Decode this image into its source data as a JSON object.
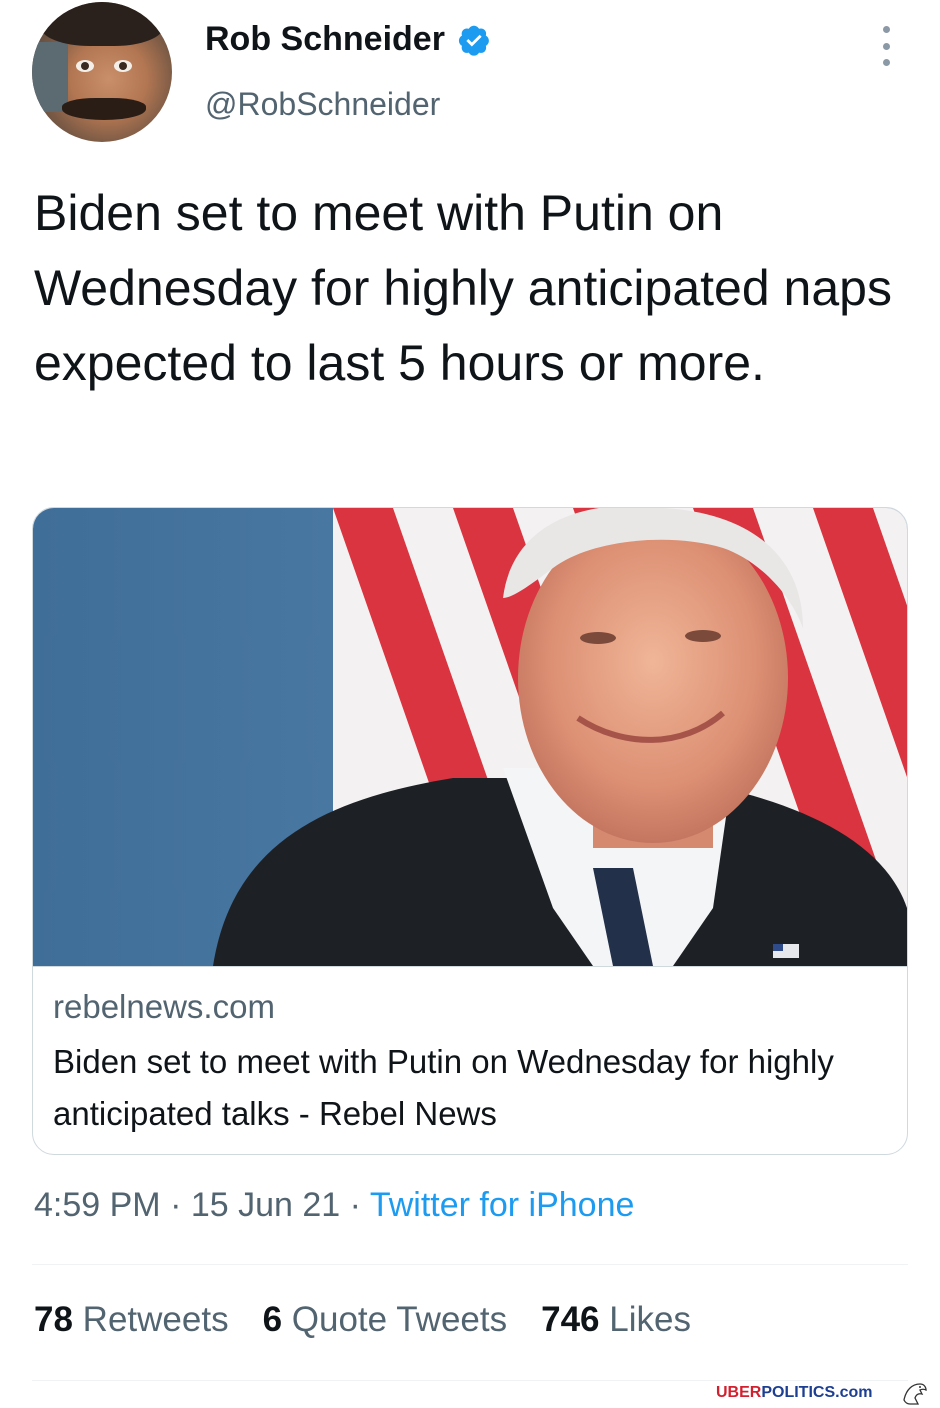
{
  "author": {
    "name": "Rob Schneider",
    "handle": "@RobSchneider",
    "verified": true
  },
  "icons": {
    "verified": "verified-badge-icon",
    "more": "more-options-icon"
  },
  "tweet": {
    "text": "Biden set to meet with Putin on Wednesday for highly anticipated naps expected to last 5 hours or more."
  },
  "card": {
    "domain": "rebelnews.com",
    "title": "Biden set to meet with Putin on Wednesday for highly anticipated talks - Rebel News"
  },
  "meta": {
    "time": "4:59 PM",
    "date": "15 Jun 21",
    "separator": "·",
    "source": "Twitter for iPhone"
  },
  "stats": {
    "retweets_count": "78",
    "retweets_label": "Retweets",
    "quotes_count": "6",
    "quotes_label": "Quote Tweets",
    "likes_count": "746",
    "likes_label": "Likes"
  },
  "watermark": {
    "uber": "UBER",
    "politics": "POLITICS.com"
  },
  "colors": {
    "accent": "#1d9bf0",
    "text": "#0f1419",
    "secondary": "#536471",
    "border": "#cfd9de"
  }
}
